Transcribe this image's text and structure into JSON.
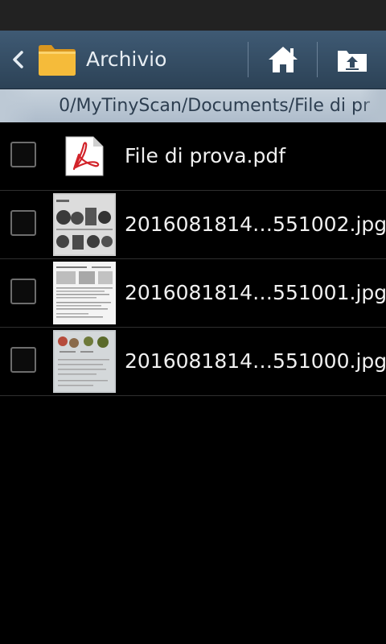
{
  "header": {
    "title": "Archivio",
    "back_icon": "chevron-left-icon",
    "folder_icon": "folder-icon",
    "home_icon": "home-icon",
    "upload_icon": "folder-up-icon"
  },
  "path": {
    "text": "0/MyTinyScan/Documents/File di pr"
  },
  "files": [
    {
      "name": "File di prova.pdf",
      "type": "pdf",
      "checked": false
    },
    {
      "name": "2016081814…551002.jpg",
      "type": "jpg",
      "checked": false
    },
    {
      "name": "2016081814…551001.jpg",
      "type": "jpg",
      "checked": false
    },
    {
      "name": "2016081814…551000.jpg",
      "type": "jpg",
      "checked": false
    }
  ],
  "colors": {
    "action_bar": "#3a5269",
    "path_bar": "#bfcad6",
    "background": "#000000",
    "pdf_red": "#d2232a",
    "folder_yellow": "#f3b531"
  }
}
